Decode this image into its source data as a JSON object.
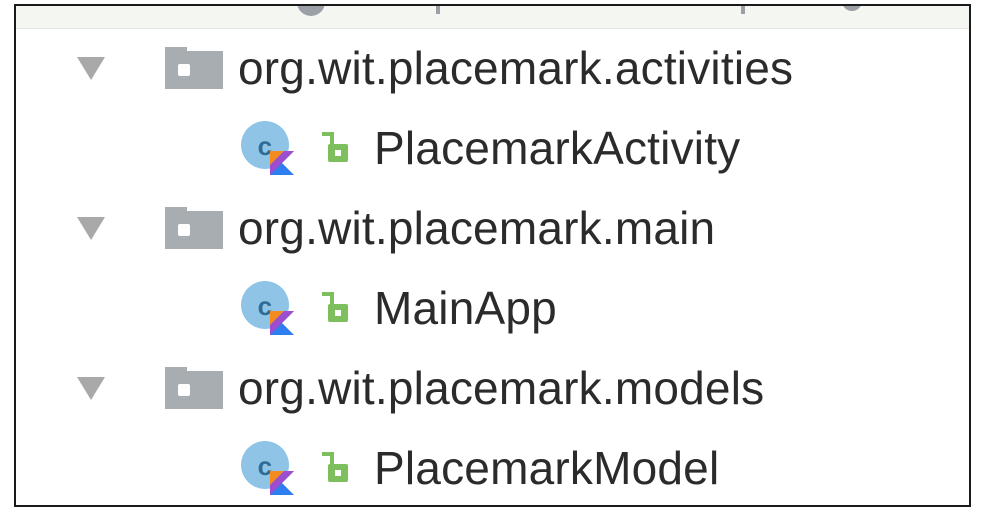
{
  "colors": {
    "text": "#2b2b2b",
    "arrow": "#a9a9a9",
    "folder": "#a8adb2",
    "class_circle": "#8fc4e6",
    "class_letter": "#2f6c98",
    "kotlin_orange": "#f58a1f",
    "kotlin_purple": "#9b4fd0",
    "kotlin_blue": "#2d7ff0",
    "lock_green": "#7dbf5c",
    "frame_border": "#1a1a1a"
  },
  "tree": {
    "packages": [
      {
        "name": "org.wit.placemark.activities",
        "icon": "folder-icon",
        "expand_icon": "chevron-down-icon",
        "children": [
          {
            "name": "PlacemarkActivity",
            "icon": "kotlin-class-icon",
            "visibility_icon": "lock-open-icon"
          }
        ]
      },
      {
        "name": "org.wit.placemark.main",
        "icon": "folder-icon",
        "expand_icon": "chevron-down-icon",
        "children": [
          {
            "name": "MainApp",
            "icon": "kotlin-class-icon",
            "visibility_icon": "lock-open-icon"
          }
        ]
      },
      {
        "name": "org.wit.placemark.models",
        "icon": "folder-icon",
        "expand_icon": "chevron-down-icon",
        "children": [
          {
            "name": "PlacemarkModel",
            "icon": "kotlin-class-icon",
            "visibility_icon": "lock-open-icon"
          }
        ]
      }
    ]
  }
}
